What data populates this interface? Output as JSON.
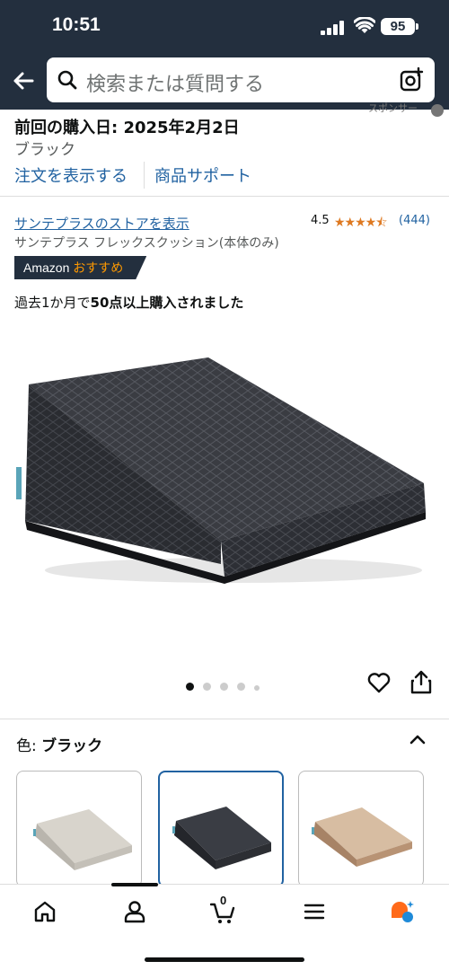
{
  "status_bar": {
    "time": "10:51",
    "battery": "95"
  },
  "search": {
    "placeholder": "検索または質問する"
  },
  "sponsored_text": "スポンサー",
  "purchase": {
    "last_purchase": "前回の購入日: 2025年2月2日",
    "color": "ブラック",
    "view_order_link": "注文を表示する",
    "product_support_link": "商品サポート"
  },
  "product": {
    "store_link": "サンテプラスのストアを表示",
    "rating_value": "4.5",
    "rating_stars": "★★★★⯪",
    "review_count": "(444)",
    "name": "サンテプラス フレックスクッション(本体のみ)",
    "badge_prefix": "Amazon",
    "badge_highlight": "おすすめ",
    "bought_prefix": "過去1か月で",
    "bought_bold": "50点以上購入されました"
  },
  "gallery": {
    "image_count": 5,
    "active_index": 0
  },
  "variant": {
    "label": "色:",
    "selected_value": "ブラック",
    "swatches": [
      {
        "name": "light-gray",
        "selected": false,
        "color": "#d8d4cc"
      },
      {
        "name": "black",
        "selected": true,
        "color": "#3a3d44"
      },
      {
        "name": "beige",
        "selected": false,
        "color": "#c9a787"
      }
    ]
  },
  "bottom_nav": {
    "cart_count": "0"
  },
  "colors": {
    "header_bg": "#232f3e",
    "link": "#2162a1",
    "star": "#de7921",
    "badge_orange": "#ff9900"
  }
}
